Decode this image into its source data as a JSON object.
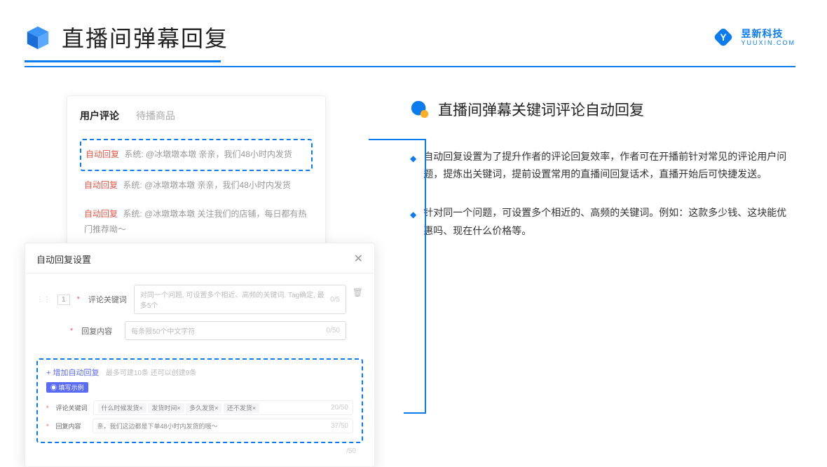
{
  "header": {
    "title": "直播间弹幕回复",
    "logo": {
      "cn": "昱新科技",
      "en": "YUUXIN.COM"
    }
  },
  "commentPanel": {
    "tabs": {
      "active": "用户评论",
      "inactive": "待播商品"
    },
    "rows": [
      {
        "tag": "自动回复",
        "text": "系统: @冰墩墩本墩 亲亲，我们48小时内发货"
      },
      {
        "tag": "自动回复",
        "text": "系统: @冰墩墩本墩 亲亲，我们48小时内发货"
      },
      {
        "tag": "自动回复",
        "text": "系统: @冰墩墩本墩 关注我们的店铺，每日都有热门推荐呦～"
      }
    ]
  },
  "settings": {
    "title": "自动回复设置",
    "rowNum": "1",
    "kwLabel": "评论关键词",
    "kwPlaceholder": "对同一个问题, 可设置多个相近、高频的关键词. Tag确定, 最多5个",
    "kwCounter": "0/5",
    "contentLabel": "回复内容",
    "contentPlaceholder": "每条限50个中文字符",
    "contentCounter": "0/50",
    "addLink": "+ 增加自动回复",
    "addHint": "最多可建10条 还可以创建9条",
    "exampleTag": "◉ 填写示例",
    "exKwLabel": "评论关键词",
    "exChips": [
      "什么时候发货×",
      "发货时间×",
      "多久发货×",
      "还不发货×"
    ],
    "exKwCounter": "20/50",
    "exContentLabel": "回复内容",
    "exContentText": "亲，我们这边都是下单48小时内发货的哦～",
    "exContentCounter": "37/50",
    "bottomCounter": "/50"
  },
  "right": {
    "heading": "直播间弹幕关键词评论自动回复",
    "bullets": [
      "自动回复设置为了提升作者的评论回复效率，作者可在开播前针对常见的评论用户问题，提炼出关键词，提前设置常用的直播间回复话术，直播开始后可快捷发送。",
      "针对同一个问题，可设置多个相近的、高频的关键词。例如：这款多少钱、这块能优惠吗、现在什么价格等。"
    ]
  }
}
